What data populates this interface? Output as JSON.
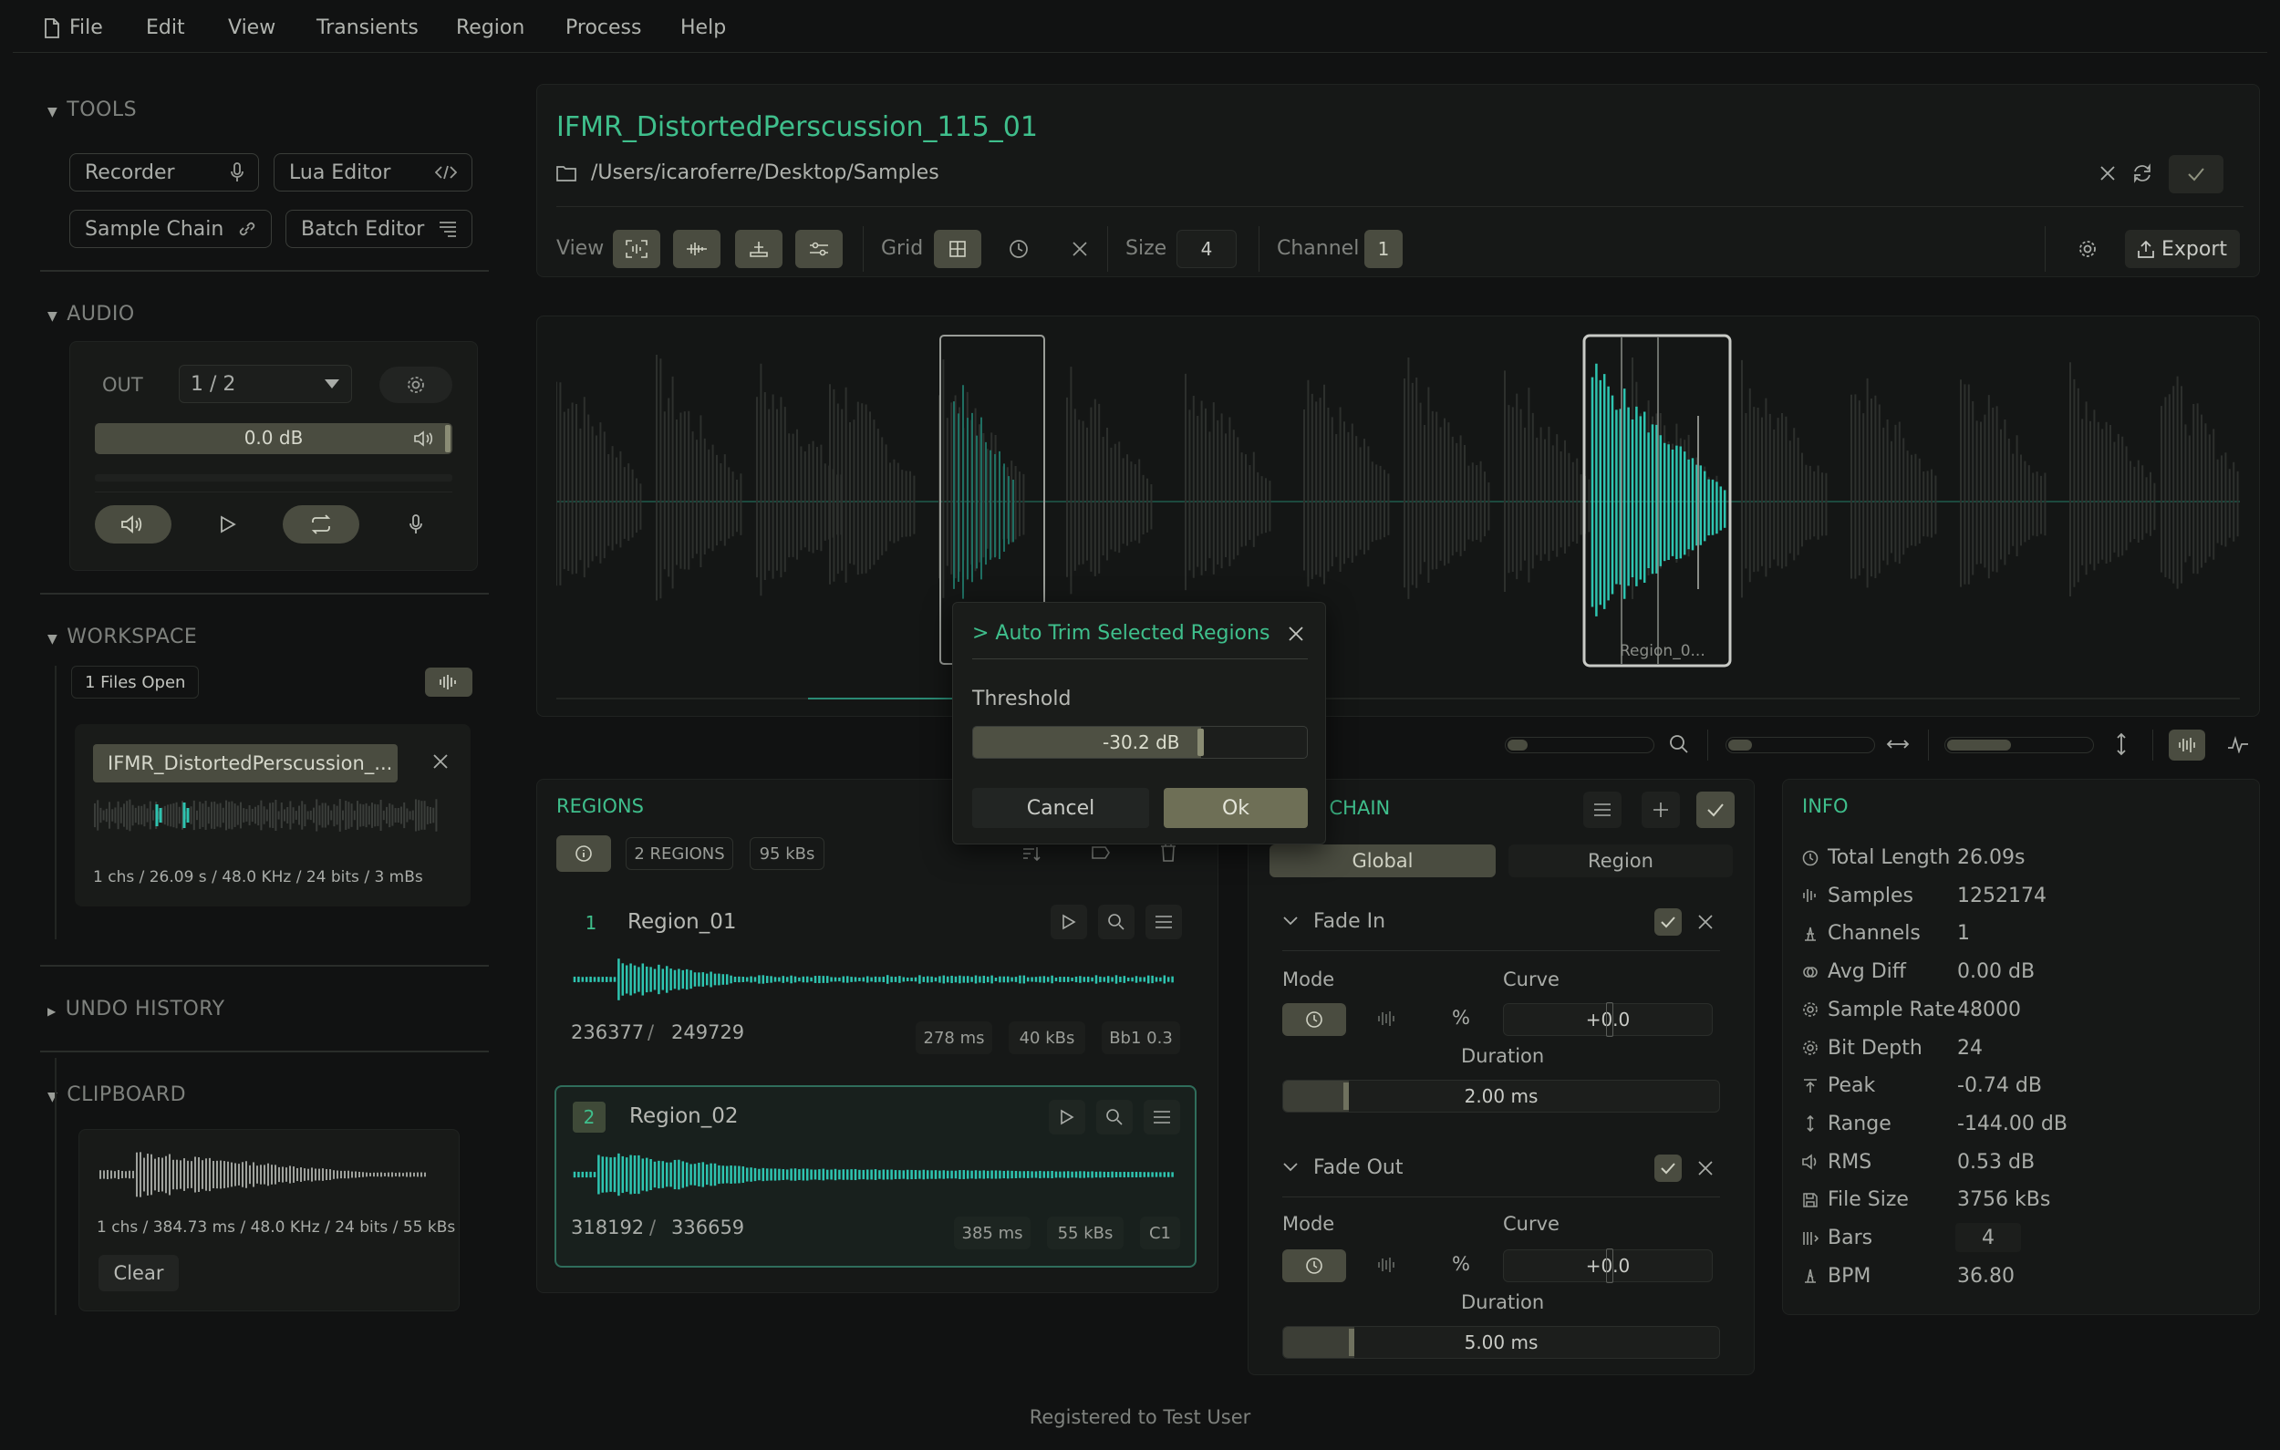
{
  "menu": {
    "file": "File",
    "edit": "Edit",
    "view": "View",
    "transients": "Transients",
    "region": "Region",
    "process": "Process",
    "help": "Help"
  },
  "sidebar": {
    "tools": {
      "title": "TOOLS",
      "recorder": "Recorder",
      "lua_editor": "Lua Editor",
      "sample_chain": "Sample Chain",
      "batch_editor": "Batch Editor"
    },
    "audio": {
      "title": "AUDIO",
      "out_label": "OUT",
      "out_value": "1 / 2",
      "volume": "0.0 dB"
    },
    "workspace": {
      "title": "WORKSPACE",
      "files_open": "1 Files Open",
      "file_name": "IFMR_DistortedPerscussion_...",
      "file_meta": "1 chs / 26.09 s / 48.0 KHz / 24 bits / 3 mBs"
    },
    "undo": {
      "title": "UNDO HISTORY"
    },
    "clipboard": {
      "title": "CLIPBOARD",
      "meta": "1 chs / 384.73 ms / 48.0 KHz / 24 bits / 55 kBs",
      "clear": "Clear"
    }
  },
  "editor": {
    "title": "IFMR_DistortedPerscussion_115_01",
    "path": "/Users/icaroferre/Desktop/Samples",
    "toolbar": {
      "view_label": "View",
      "grid_label": "Grid",
      "size_label": "Size",
      "size_value": "4",
      "channel_label": "Channel",
      "channel_value": "1",
      "export": "Export"
    },
    "region_label": "Region_0..."
  },
  "regions": {
    "title": "REGIONS",
    "count": "2 REGIONS",
    "size": "95 kBs",
    "items": [
      {
        "index": "1",
        "name": "Region_01",
        "start": "236377",
        "sep": "/",
        "end": "249729",
        "duration": "278 ms",
        "size": "40 kBs",
        "note": "Bb1 0.3"
      },
      {
        "index": "2",
        "name": "Region_02",
        "start": "318192",
        "sep": "/",
        "end": "336659",
        "duration": "385 ms",
        "size": "55 kBs",
        "note": "C1"
      }
    ]
  },
  "fx_chain": {
    "title": "T CHAIN",
    "tab_global": "Global",
    "tab_region": "Region",
    "fade_in": {
      "title": "Fade In",
      "mode": "Mode",
      "curve": "Curve",
      "curve_value": "+0.0",
      "duration_label": "Duration",
      "duration": "2.00 ms",
      "percent": "%"
    },
    "fade_out": {
      "title": "Fade Out",
      "mode": "Mode",
      "curve": "Curve",
      "curve_value": "+0.0",
      "duration_label": "Duration",
      "duration": "5.00 ms",
      "percent": "%"
    }
  },
  "info": {
    "title": "INFO",
    "rows": [
      {
        "label": "Total Length",
        "value": "26.09s"
      },
      {
        "label": "Samples",
        "value": "1252174"
      },
      {
        "label": "Channels",
        "value": "1"
      },
      {
        "label": "Avg Diff",
        "value": "0.00 dB"
      },
      {
        "label": "Sample Rate",
        "value": "48000"
      },
      {
        "label": "Bit Depth",
        "value": "24"
      },
      {
        "label": "Peak",
        "value": "-0.74 dB"
      },
      {
        "label": "Range",
        "value": "-144.00 dB"
      },
      {
        "label": "RMS",
        "value": "0.53 dB"
      },
      {
        "label": "File Size",
        "value": "3756 kBs"
      },
      {
        "label": "Bars",
        "value": "4"
      },
      {
        "label": "BPM",
        "value": "36.80"
      }
    ]
  },
  "dialog": {
    "title": "> Auto Trim Selected Regions",
    "threshold_label": "Threshold",
    "threshold_value": "-30.2 dB",
    "threshold_fraction": 0.68,
    "cancel": "Cancel",
    "ok": "Ok"
  },
  "footer": {
    "registered": "Registered to Test User"
  },
  "colors": {
    "accent_green": "#3fbf8c",
    "waveform_teal": "#2ec4b0",
    "button_olive": "#4a4c40"
  }
}
